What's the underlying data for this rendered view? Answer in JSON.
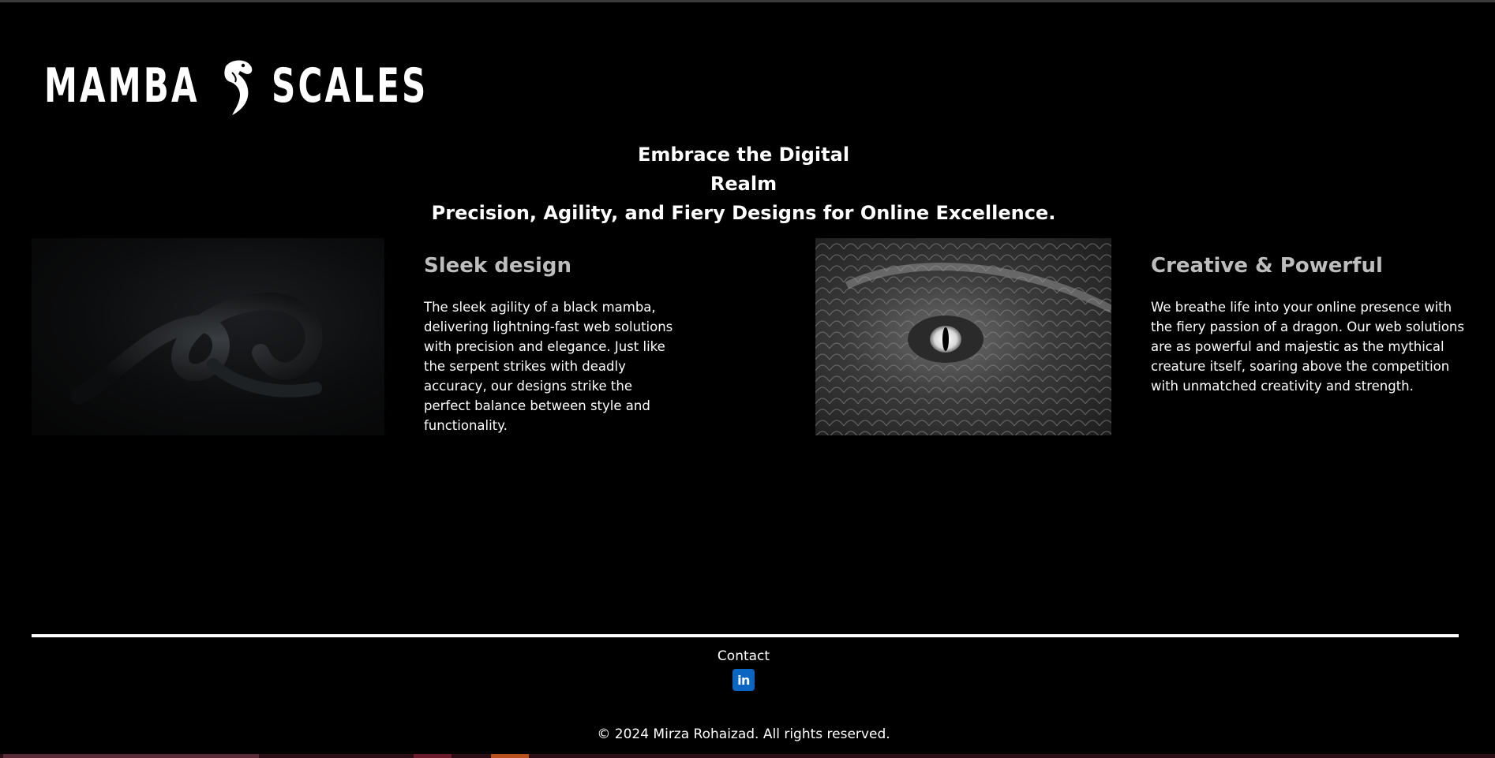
{
  "brand": {
    "word_left": "MAMBA",
    "word_right": "SCALES",
    "icon": "snake-icon"
  },
  "hero": {
    "line1": "Embrace the Digital",
    "line2": "Realm",
    "line3": "Precision, Agility, and Fiery Designs for Online Excellence."
  },
  "features": [
    {
      "title": "Sleek design",
      "text": "The sleek agility of a black mamba, delivering lightning-fast web solutions with precision and elegance. Just like the serpent strikes with deadly accuracy, our designs strike the perfect balance between style and functionality."
    },
    {
      "title": "Creative & Powerful",
      "text": "We breathe life into your online presence with the fiery passion of a dragon. Our web solutions are as powerful and majestic as the mythical creature itself, soaring above the competition with unmatched creativity and strength."
    }
  ],
  "footer": {
    "contact_label": "Contact",
    "linkedin_glyph": "in",
    "linkedin_icon": "linkedin-icon",
    "copyright": "© 2024 Mirza Rohaizad. All rights reserved."
  },
  "colors": {
    "background": "#000000",
    "text": "#ffffff",
    "card_title": "#bdbdbd",
    "linkedin": "#0a66c2"
  }
}
